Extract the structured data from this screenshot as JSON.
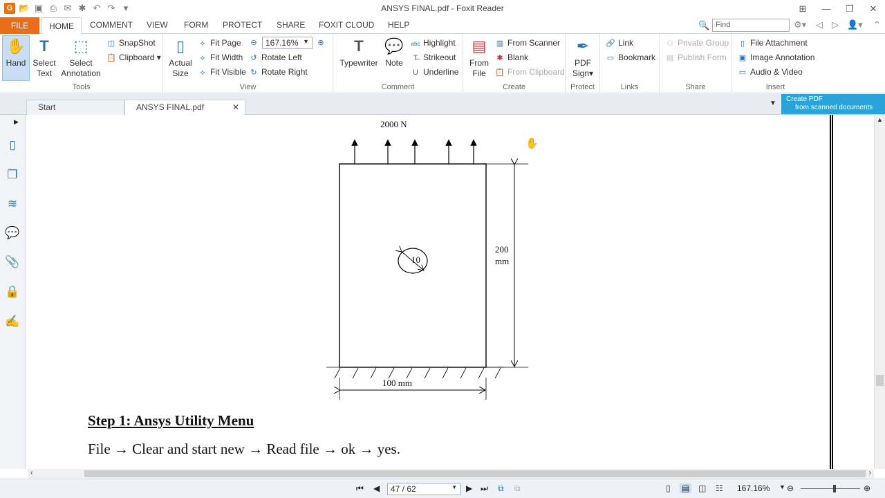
{
  "window": {
    "title": "ANSYS FINAL.pdf - Foxit Reader"
  },
  "menu": {
    "file": "FILE",
    "tabs": [
      "HOME",
      "COMMENT",
      "VIEW",
      "FORM",
      "PROTECT",
      "SHARE",
      "FOXIT CLOUD",
      "HELP"
    ],
    "find_placeholder": "Find"
  },
  "ribbon": {
    "tools": {
      "label": "Tools",
      "hand": "Hand",
      "select_text_1": "Select",
      "select_text_2": "Text",
      "select_ann_1": "Select",
      "select_ann_2": "Annotation",
      "snapshot": "SnapShot",
      "clipboard": "Clipboard"
    },
    "view": {
      "label": "View",
      "actual_1": "Actual",
      "actual_2": "Size",
      "fit_page": "Fit Page",
      "fit_width": "Fit Width",
      "fit_visible": "Fit Visible",
      "zoom": "167.16%",
      "rotate_left": "Rotate Left",
      "rotate_right": "Rotate Right"
    },
    "comment": {
      "label": "Comment",
      "typewriter": "Typewriter",
      "note": "Note",
      "highlight": "Highlight",
      "strikeout": "Strikeout",
      "underline": "Underline"
    },
    "create": {
      "label": "Create",
      "from_file_1": "From",
      "from_file_2": "File",
      "from_scanner": "From Scanner",
      "blank": "Blank",
      "from_clipboard": "From Clipboard"
    },
    "protect": {
      "label": "Protect",
      "pdf_sign_1": "PDF",
      "pdf_sign_2": "Sign"
    },
    "links": {
      "label": "Links",
      "link": "Link",
      "bookmark": "Bookmark"
    },
    "share": {
      "label": "Share",
      "private_group": "Private Group",
      "publish_form": "Publish Form"
    },
    "insert": {
      "label": "Insert",
      "file_attachment": "File Attachment",
      "image_annotation": "Image Annotation",
      "audio_video": "Audio & Video"
    }
  },
  "tabs": [
    {
      "label": "Start"
    },
    {
      "label": "ANSYS FINAL.pdf"
    }
  ],
  "banner": {
    "line1": "Create PDF",
    "line2": "from scanned documents"
  },
  "document": {
    "force": "2000 N",
    "height_value": "200",
    "height_unit": "mm",
    "hole": "10",
    "width": "100 mm",
    "step_heading": "Step 1: Ansys Utility Menu",
    "step_text": "File → Clear and start new → Read file → ok → yes."
  },
  "status": {
    "page": "47 / 62",
    "zoom": "167.16%"
  },
  "colors": {
    "file_tab": "#e96d1a",
    "accent": "#2b6fb5",
    "banner": "#2aa3db"
  }
}
